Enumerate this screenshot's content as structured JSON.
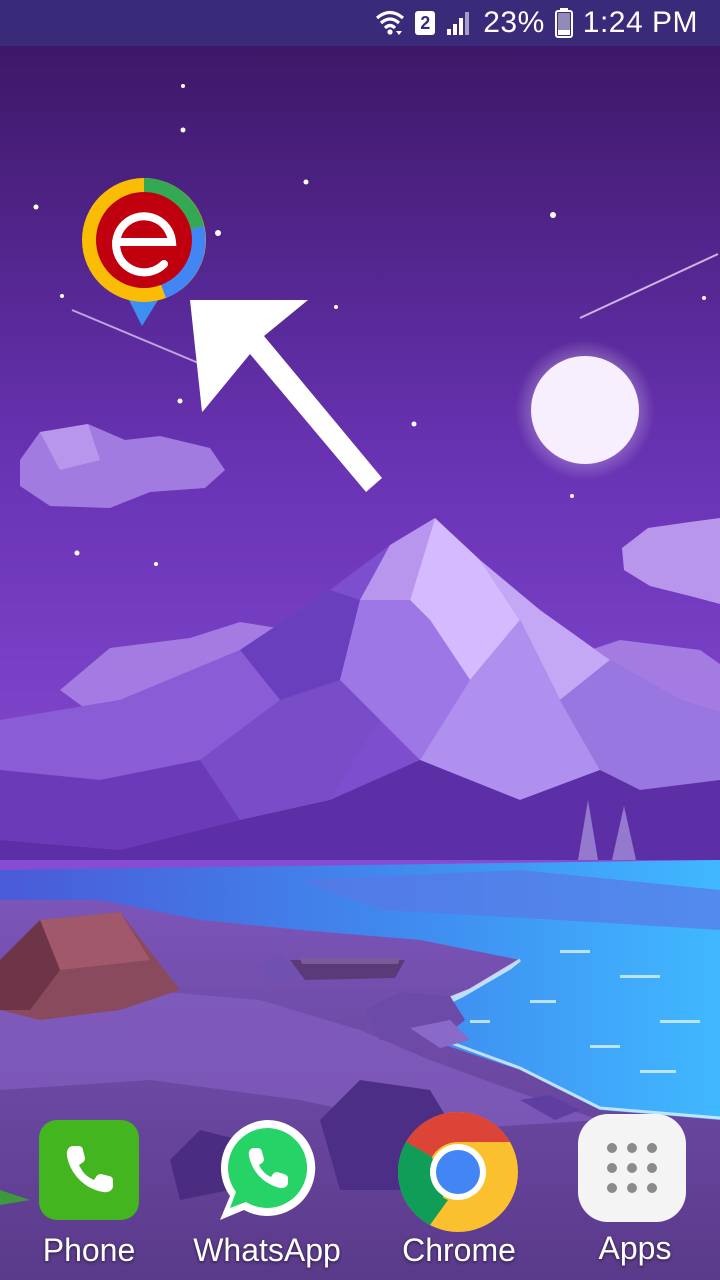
{
  "status_bar": {
    "sim_slot": "2",
    "battery_percent": "23%",
    "time": "1:24 PM",
    "icons": [
      "wifi-icon",
      "sim-2-icon",
      "signal-icon",
      "battery-icon"
    ]
  },
  "wallpaper": {
    "description_icon": "low-poly-mountain-lake-wallpaper"
  },
  "floating_shortcut": {
    "icon": "edge-browser-bubble-icon",
    "pointer": "arrow-pointer-icon"
  },
  "dock": {
    "apps": [
      {
        "label": "Phone",
        "icon": "phone-icon",
        "color": "#43b51f"
      },
      {
        "label": "WhatsApp",
        "icon": "whatsapp-icon",
        "color": "#25d366"
      },
      {
        "label": "Chrome",
        "icon": "chrome-icon",
        "color": "#db4437"
      },
      {
        "label": "Apps",
        "icon": "apps-grid-icon",
        "color": "#f4f4f4"
      }
    ]
  }
}
